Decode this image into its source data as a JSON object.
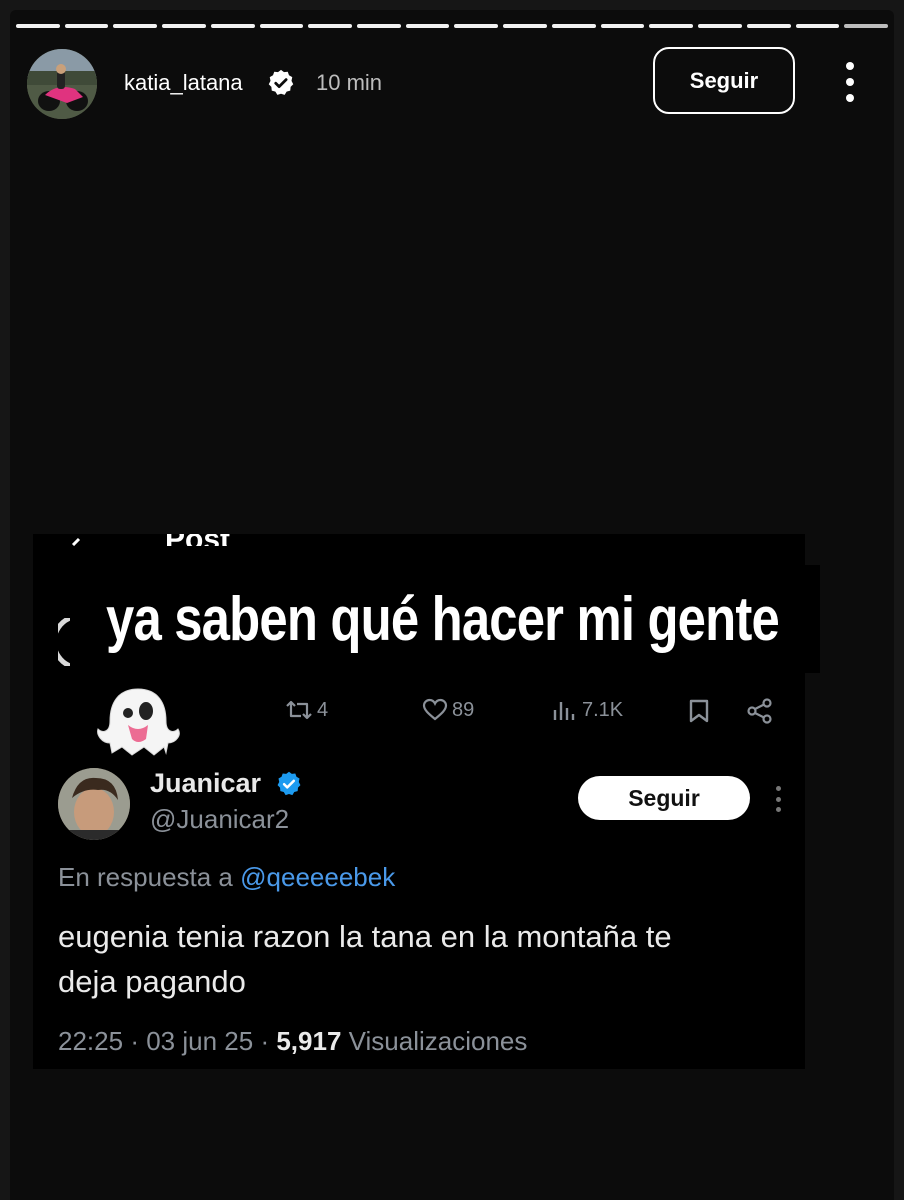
{
  "story": {
    "username": "katia_latana",
    "time": "10 min",
    "follow_label": "Seguir",
    "segments": 18,
    "icons": [
      "verified-badge-icon",
      "more-vertical-icon"
    ]
  },
  "screenshot": {
    "header_partial": "Post",
    "caption": "ya saben qué hacer mi gente",
    "emoji": "ghost",
    "actions": {
      "retweets": "4",
      "likes": "89",
      "views": "7.1K"
    },
    "tweet": {
      "name": "Juanicar",
      "handle": "@Juanicar2",
      "follow_label": "Seguir",
      "reply_prefix": "En respuesta a",
      "reply_to": "@qeeeeebek",
      "text_line1": "eugenia tenia razon la tana en la montaña te",
      "text_line2": "deja pagando",
      "time": "22:25",
      "date": "03 jun 25",
      "views_count": "5,917",
      "views_label": "Visualizaciones"
    }
  },
  "colors": {
    "background": "#0c0c0c",
    "link": "#4a99e9",
    "muted": "#8b9199",
    "verified": "#1d9bf0"
  }
}
